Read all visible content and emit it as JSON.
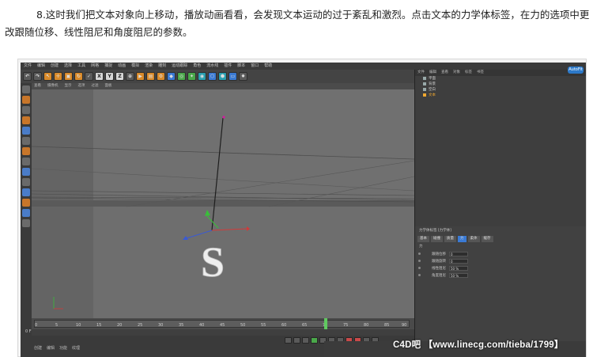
{
  "article": {
    "paragraph": "8.这时我们把文本对象向上移动，播放动画看看，会发现文本运动的过于紊乱和激烈。点击文本的力学体标签，在力的选项中更改跟随位移、线性阻尼和角度阻尼的参数。"
  },
  "c4d": {
    "logo_text": "AutoFit",
    "toolbar_xyz": [
      "X",
      "Y",
      "Z"
    ],
    "viewport_tabs": [
      "查看",
      "摄像机",
      "显示",
      "选项",
      "过滤",
      "面板"
    ],
    "objects_tabs": [
      "文件",
      "编辑",
      "查看",
      "对象",
      "标签",
      "书签"
    ],
    "objects": [
      {
        "name": "平面"
      },
      {
        "name": "背景"
      },
      {
        "name": "空白"
      },
      {
        "name": "文本"
      }
    ],
    "attr_tabs": [
      "基本",
      "碰撞",
      "质量",
      "力",
      "柔体",
      "缓存"
    ],
    "attr_active": "力",
    "attr_title": "力学体标签 [力学体]",
    "attr_section": "力",
    "attr_rows": [
      {
        "label": "跟随位移",
        "value": "0"
      },
      {
        "label": "跟随旋转",
        "value": "0"
      },
      {
        "label": "线性阻尼",
        "value": "50 %"
      },
      {
        "label": "角度阻尼",
        "value": "50 %"
      }
    ],
    "timeline_ticks": [
      "0",
      "5",
      "10",
      "15",
      "20",
      "25",
      "30",
      "35",
      "40",
      "45",
      "50",
      "55",
      "60",
      "65",
      "70",
      "75",
      "80",
      "85",
      "90"
    ],
    "bottom_tabs": [
      "创建",
      "编辑",
      "功能",
      "纹理"
    ],
    "frames": "0 F",
    "watermark": "C4D吧 【www.linecg.com/tieba/1799】"
  }
}
